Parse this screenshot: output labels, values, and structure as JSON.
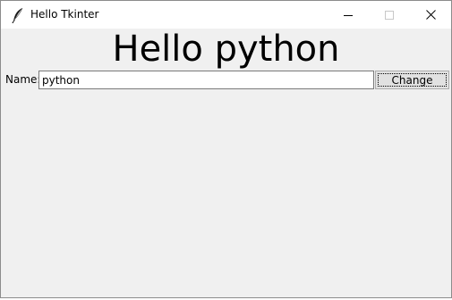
{
  "window": {
    "title": "Hello Tkinter",
    "icons": {
      "app": "feather-icon",
      "minimize": "minimize-icon",
      "maximize": "maximize-icon",
      "close": "close-icon"
    }
  },
  "main": {
    "heading": "Hello python",
    "name_label": "Name:",
    "name_value": "python",
    "change_label": "Change"
  },
  "colors": {
    "window_background": "#f0f0f0",
    "titlebar_background": "#ffffff",
    "button_background": "#e1e1e1"
  }
}
